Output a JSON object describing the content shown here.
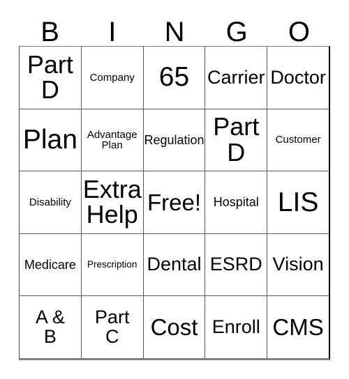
{
  "card": {
    "title_letters": [
      "B",
      "I",
      "N",
      "G",
      "O"
    ],
    "free_space_label": "Free!",
    "rows": [
      [
        {
          "label": "Part\nD",
          "size": "xl"
        },
        {
          "label": "Company",
          "size": "xxs"
        },
        {
          "label": "65",
          "size": "xxl"
        },
        {
          "label": "Carrier",
          "size": "md"
        },
        {
          "label": "Doctor",
          "size": "md"
        }
      ],
      [
        {
          "label": "Plan",
          "size": "xxl"
        },
        {
          "label": "Advantage\nPlan",
          "size": "xxs"
        },
        {
          "label": "Regulation",
          "size": "xs"
        },
        {
          "label": "Part\nD",
          "size": "xl"
        },
        {
          "label": "Customer",
          "size": "xxs"
        }
      ],
      [
        {
          "label": "Disability",
          "size": "xxs"
        },
        {
          "label": "Extra\nHelp",
          "size": "xl"
        },
        {
          "label": "Free!",
          "size": "lg"
        },
        {
          "label": "Hospital",
          "size": "xs"
        },
        {
          "label": "LIS",
          "size": "xxl"
        }
      ],
      [
        {
          "label": "Medicare",
          "size": "xs"
        },
        {
          "label": "Prescription",
          "size": "tiny"
        },
        {
          "label": "Dental",
          "size": "md"
        },
        {
          "label": "ESRD",
          "size": "md"
        },
        {
          "label": "Vision",
          "size": "md"
        }
      ],
      [
        {
          "label": "A &\nB",
          "size": "md"
        },
        {
          "label": "Part\nC",
          "size": "md"
        },
        {
          "label": "Cost",
          "size": "lg"
        },
        {
          "label": "Enroll",
          "size": "md"
        },
        {
          "label": "CMS",
          "size": "lg"
        }
      ]
    ]
  }
}
